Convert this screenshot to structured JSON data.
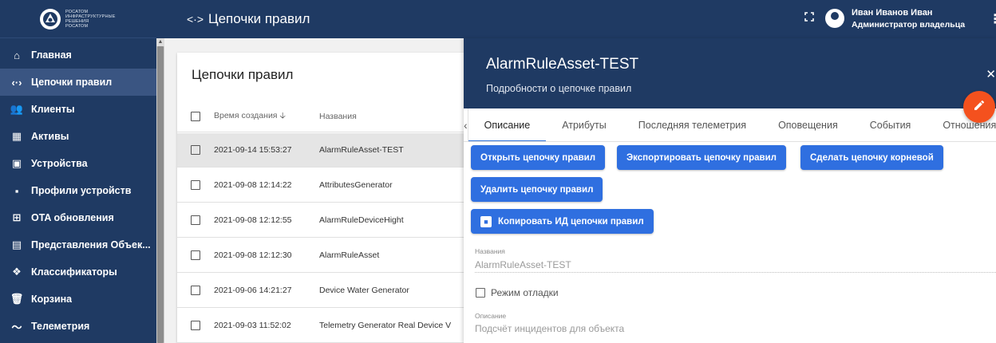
{
  "logo": {
    "lines": [
      "Росатом",
      "Инфраструктурные",
      "решения",
      "Росатом"
    ]
  },
  "topbar": {
    "title": "Цепочки правил",
    "title_icon": "<·>"
  },
  "user": {
    "name": "Иван Иванов Иван",
    "role": "Администратор владельца"
  },
  "sidebar": {
    "items": [
      {
        "label": "Главная",
        "icon": "home-icon",
        "glyph": "⌂"
      },
      {
        "label": "Цепочки правил",
        "icon": "code-icon",
        "glyph": "‹·›"
      },
      {
        "label": "Клиенты",
        "icon": "people-icon",
        "glyph": "👥"
      },
      {
        "label": "Активы",
        "icon": "domain-icon",
        "glyph": "▦"
      },
      {
        "label": "Устройства",
        "icon": "devices-icon",
        "glyph": "▣"
      },
      {
        "label": "Профили устройств",
        "icon": "profile-icon",
        "glyph": "▪"
      },
      {
        "label": "OTA обновления",
        "icon": "memory-icon",
        "glyph": "⊞"
      },
      {
        "label": "Представления Объек...",
        "icon": "view-icon",
        "glyph": "▤"
      },
      {
        "label": "Классификаторы",
        "icon": "classifier-icon",
        "glyph": "❖"
      },
      {
        "label": "Корзина",
        "icon": "trash-icon",
        "glyph": "🗑"
      },
      {
        "label": "Телеметрия",
        "icon": "telemetry-icon",
        "glyph": "〜"
      }
    ]
  },
  "table": {
    "title": "Цепочки правил",
    "col_time": "Время создания",
    "col_name": "Названия",
    "rows": [
      {
        "time": "2021-09-14 15:53:27",
        "name": "AlarmRuleAsset-TEST"
      },
      {
        "time": "2021-09-08 12:14:22",
        "name": "AttributesGenerator"
      },
      {
        "time": "2021-09-08 12:12:55",
        "name": "AlarmRuleDeviceHight"
      },
      {
        "time": "2021-09-08 12:12:30",
        "name": "AlarmRuleAsset"
      },
      {
        "time": "2021-09-06 14:21:27",
        "name": "Device Water Generator"
      },
      {
        "time": "2021-09-03 11:52:02",
        "name": "Telemetry Generator Real Device V"
      }
    ]
  },
  "panel": {
    "title": "AlarmRuleAsset-TEST",
    "subtitle": "Подробности о цепочке правил",
    "tabs": [
      "Описание",
      "Атрибуты",
      "Последняя телеметрия",
      "Оповещения",
      "События",
      "Отношения"
    ],
    "buttons": {
      "open": "Открыть цепочку правил",
      "export": "Экспортировать цепочку правил",
      "root": "Сделать цепочку корневой",
      "delete": "Удалить цепочку правил",
      "copy_id": "Копировать ИД цепочки правил"
    },
    "name_label": "Названия",
    "name_value": "AlarmRuleAsset-TEST",
    "debug_label": "Режим отладки",
    "desc_label": "Описание",
    "desc_value": "Подсчёт инцидентов для объекта"
  },
  "colors": {
    "primary": "#1f3a63",
    "accent": "#2f6fe0",
    "fab": "#f4511e"
  }
}
